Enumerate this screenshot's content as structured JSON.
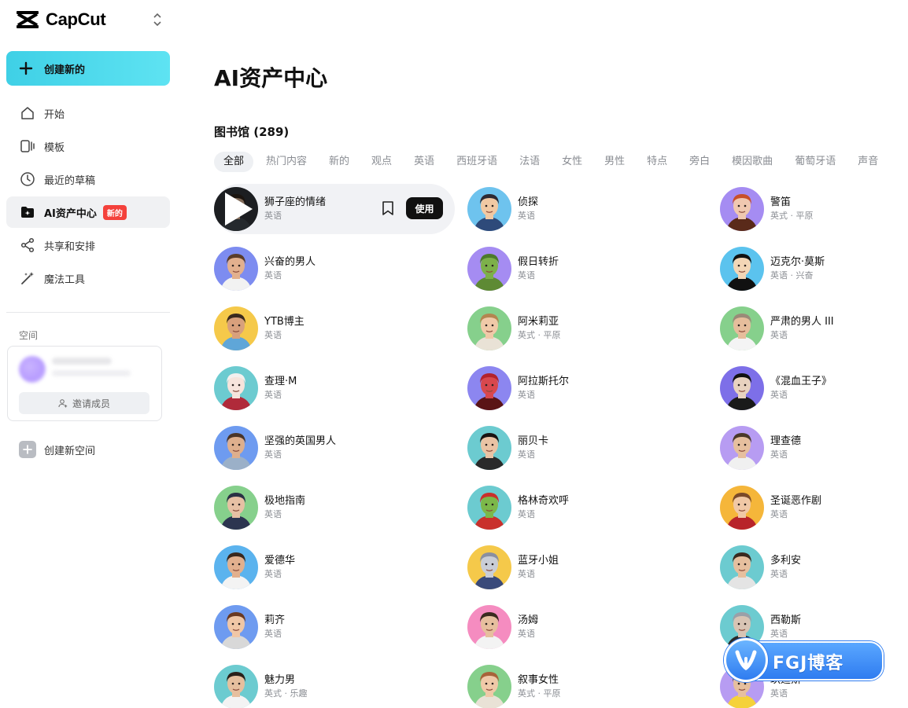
{
  "app": {
    "name": "CapCut"
  },
  "sidebar": {
    "create_label": "创建新的",
    "items": [
      {
        "label": "开始",
        "icon": "home-icon"
      },
      {
        "label": "模板",
        "icon": "template-icon"
      },
      {
        "label": "最近的草稿",
        "icon": "clock-icon"
      },
      {
        "label": "AI资产中心",
        "icon": "ai-folder-icon",
        "badge": "新的",
        "active": true
      },
      {
        "label": "共享和安排",
        "icon": "share-icon"
      },
      {
        "label": "魔法工具",
        "icon": "magic-wand-icon"
      }
    ],
    "space_label": "空间",
    "invite_label": "邀请成员",
    "new_space_label": "创建新空间"
  },
  "main": {
    "title": "AI资产中心",
    "library_title": "图书馆 (289)",
    "tabs": [
      "全部",
      "热门内容",
      "新的",
      "观点",
      "英语",
      "西班牙语",
      "法语",
      "女性",
      "男性",
      "特点",
      "旁白",
      "模因歌曲",
      "葡萄牙语",
      "声音"
    ],
    "active_tab": "全部",
    "use_label": "使用",
    "voices": [
      {
        "name": "狮子座的情绪",
        "sub": "英语",
        "bg": "#2b2f33",
        "skin": "#c7a58a",
        "hair": "#2a2018",
        "shirt": "#3a3f45",
        "highlighted": true
      },
      {
        "name": "侦探",
        "sub": "英语",
        "bg": "#6ec3ee",
        "skin": "#f1c9a3",
        "hair": "#2d2a33",
        "shirt": "#2e4a7a"
      },
      {
        "name": "警笛",
        "sub": "英式 · 平原",
        "bg": "#a58cf2",
        "skin": "#f0c8b0",
        "hair": "#c8502a",
        "shirt": "#5a2a1a"
      },
      {
        "name": "兴奋的男人",
        "sub": "英语",
        "bg": "#7d8cf0",
        "skin": "#e2b08e",
        "hair": "#5a3d2a",
        "shirt": "#f2f2f2"
      },
      {
        "name": "假日转折",
        "sub": "英语",
        "bg": "#a58cf2",
        "skin": "#7db04a",
        "hair": "#4c7a2a",
        "shirt": "#5e8a34"
      },
      {
        "name": "迈克尔·莫斯",
        "sub": "英语 · 兴奋",
        "bg": "#5bc3ee",
        "skin": "#f3d6b6",
        "hair": "#111111",
        "shirt": "#111111"
      },
      {
        "name": "YTB博主",
        "sub": "英语",
        "bg": "#f5c94a",
        "skin": "#d8a07c",
        "hair": "#3a2a1f",
        "shirt": "#5fa6d8"
      },
      {
        "name": "阿米莉亚",
        "sub": "英式 · 平原",
        "bg": "#86d08c",
        "skin": "#f0c9a8",
        "hair": "#b48550",
        "shirt": "#e9e2d6"
      },
      {
        "name": "严肃的男人 III",
        "sub": "英语",
        "bg": "#86d08c",
        "skin": "#e6bd9c",
        "hair": "#9a8a78",
        "shirt": "#f4f4f4"
      },
      {
        "name": "查理·M",
        "sub": "英语",
        "bg": "#6ccbd0",
        "skin": "#f6e4dc",
        "hair": "#f3f0ee",
        "shirt": "#b02a3a"
      },
      {
        "name": "阿拉斯托尔",
        "sub": "英语",
        "bg": "#8c86f0",
        "skin": "#d8484e",
        "hair": "#b3222c",
        "shirt": "#5a1416"
      },
      {
        "name": "《混血王子》",
        "sub": "英语",
        "bg": "#7d6fe8",
        "skin": "#e8d2bf",
        "hair": "#111111",
        "shirt": "#1a1a1a"
      },
      {
        "name": "坚强的英国男人",
        "sub": "英语",
        "bg": "#6e9bf0",
        "skin": "#deaf8d",
        "hair": "#4a3528",
        "shirt": "#9bb0c8"
      },
      {
        "name": "丽贝卡",
        "sub": "英语",
        "bg": "#6ccbd0",
        "skin": "#e9c3a4",
        "hair": "#1a1412",
        "shirt": "#2a2a2a"
      },
      {
        "name": "理查德",
        "sub": "英语",
        "bg": "#b79cf2",
        "skin": "#e6bf9e",
        "hair": "#4a3828",
        "shirt": "#f0f0f0"
      },
      {
        "name": "极地指南",
        "sub": "英语",
        "bg": "#86d08c",
        "skin": "#e6c0a4",
        "hair": "#2a3145",
        "shirt": "#2c3550"
      },
      {
        "name": "格林奇欢呼",
        "sub": "英语",
        "bg": "#6ccbd0",
        "skin": "#7cb84a",
        "hair": "#c9302c",
        "shirt": "#c9302c"
      },
      {
        "name": "圣诞恶作剧",
        "sub": "英语",
        "bg": "#f5b63a",
        "skin": "#f0c8a6",
        "hair": "#7a4a2a",
        "shirt": "#b8242a"
      },
      {
        "name": "爱德华",
        "sub": "英语",
        "bg": "#5bb3ee",
        "skin": "#e2b08e",
        "hair": "#3a281d",
        "shirt": "#f3f3f3"
      },
      {
        "name": "蓝牙小姐",
        "sub": "英语",
        "bg": "#f5c94a",
        "skin": "#c9cdd6",
        "hair": "#8a8fa0",
        "shirt": "#3a4a7a"
      },
      {
        "name": "多利安",
        "sub": "英语",
        "bg": "#6ccbd0",
        "skin": "#e6bf9e",
        "hair": "#3a2a1f",
        "shirt": "#e4e4e4"
      },
      {
        "name": "莉齐",
        "sub": "英语",
        "bg": "#6e9bf0",
        "skin": "#f0c7a6",
        "hair": "#6a3a22",
        "shirt": "#d8d8d8"
      },
      {
        "name": "汤姆",
        "sub": "英语",
        "bg": "#f58cc0",
        "skin": "#e6bf9e",
        "hair": "#3a2a1f",
        "shirt": "#f3f3f3"
      },
      {
        "name": "西勒斯",
        "sub": "英语",
        "bg": "#6ccbd0",
        "skin": "#d8c4b4",
        "hair": "#9aa0a8",
        "shirt": "#2a2a2a"
      },
      {
        "name": "魅力男",
        "sub": "英式 · 乐趣",
        "bg": "#6ccbd0",
        "skin": "#e6bf9e",
        "hair": "#2a201a",
        "shirt": "#f3f3f3"
      },
      {
        "name": "叙事女性",
        "sub": "英式 · 平原",
        "bg": "#86d08c",
        "skin": "#f0c9a8",
        "hair": "#a8643a",
        "shirt": "#e9e2d6"
      },
      {
        "name": "玖迪斯",
        "sub": "英语",
        "bg": "#b79cf2",
        "skin": "#e6bf9e",
        "hair": "#6a4a2a",
        "shirt": "#f5d23a"
      }
    ]
  },
  "watermark": {
    "text": "FGJ博客"
  }
}
